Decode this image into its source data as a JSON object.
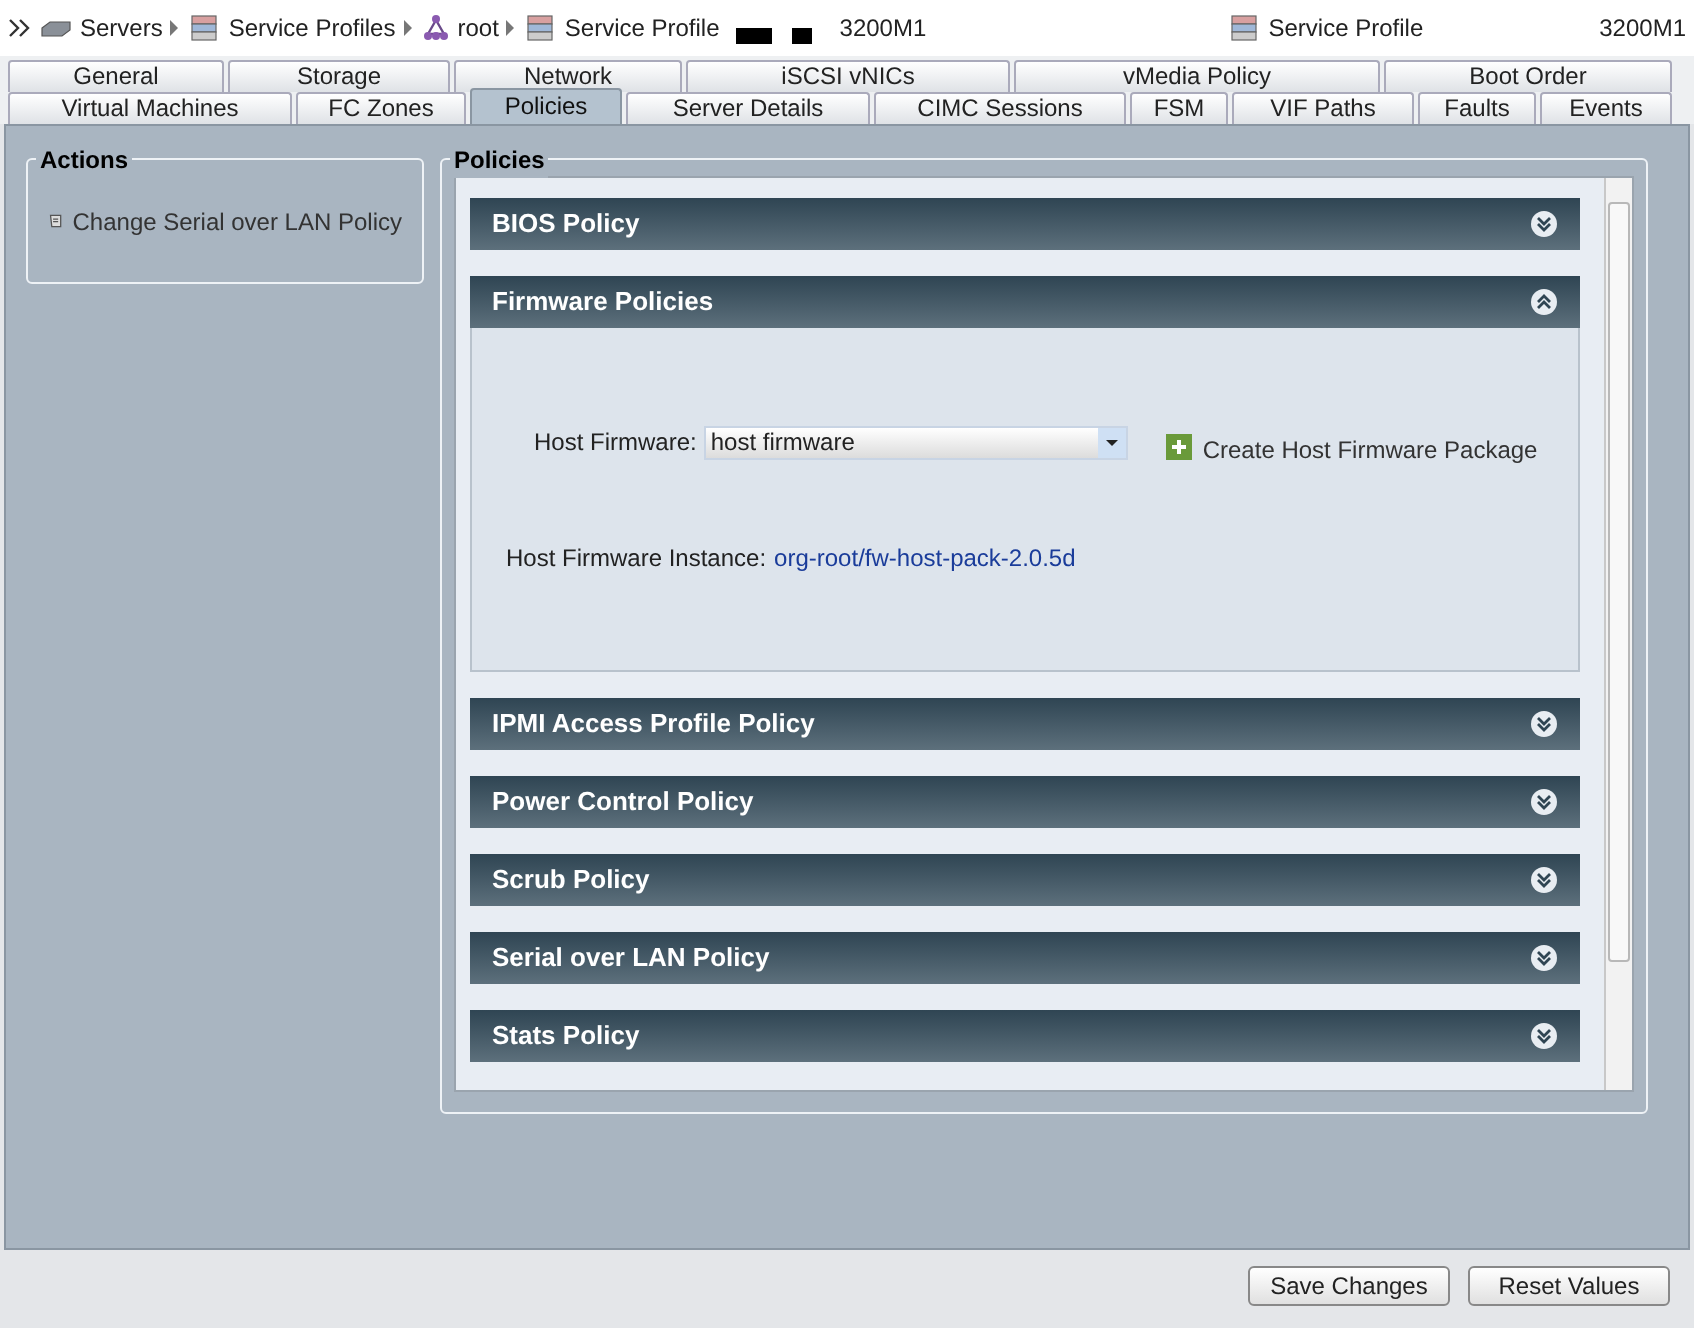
{
  "breadcrumb": [
    {
      "label": "Servers"
    },
    {
      "label": "Service Profiles"
    },
    {
      "label": "root"
    },
    {
      "label": "Service Profile",
      "suffix": "3200M1"
    }
  ],
  "header_right": {
    "label": "Service Profile",
    "suffix": "3200M1"
  },
  "tab_rows": [
    [
      {
        "label": "General",
        "selected": false
      },
      {
        "label": "Storage",
        "selected": false
      },
      {
        "label": "Network",
        "selected": false
      },
      {
        "label": "iSCSI vNICs",
        "selected": false
      },
      {
        "label": "vMedia Policy",
        "selected": false
      },
      {
        "label": "Boot Order",
        "selected": false
      }
    ],
    [
      {
        "label": "Virtual Machines",
        "selected": false
      },
      {
        "label": "FC Zones",
        "selected": false
      },
      {
        "label": "Policies",
        "selected": true
      },
      {
        "label": "Server Details",
        "selected": false
      },
      {
        "label": "CIMC Sessions",
        "selected": false
      },
      {
        "label": "FSM",
        "selected": false
      },
      {
        "label": "VIF Paths",
        "selected": false
      },
      {
        "label": "Faults",
        "selected": false
      },
      {
        "label": "Events",
        "selected": false
      }
    ]
  ],
  "actions": {
    "title": "Actions",
    "items": [
      {
        "label": "Change Serial over LAN Policy"
      }
    ]
  },
  "policies": {
    "title": "Policies",
    "sections": [
      {
        "title": "BIOS Policy",
        "expanded": false
      },
      {
        "title": "Firmware Policies",
        "expanded": true,
        "field_label": "Host Firmware:",
        "field_value": "host firmware",
        "create_link": "Create Host Firmware Package",
        "instance_label": "Host Firmware Instance:",
        "instance_value": "org-root/fw-host-pack-2.0.5d"
      },
      {
        "title": "IPMI Access Profile Policy",
        "expanded": false
      },
      {
        "title": "Power Control Policy",
        "expanded": false
      },
      {
        "title": "Scrub Policy",
        "expanded": false
      },
      {
        "title": "Serial over LAN Policy",
        "expanded": false
      },
      {
        "title": "Stats Policy",
        "expanded": false
      }
    ]
  },
  "buttons": [
    {
      "label": "Save Changes"
    },
    {
      "label": "Reset Values"
    }
  ]
}
